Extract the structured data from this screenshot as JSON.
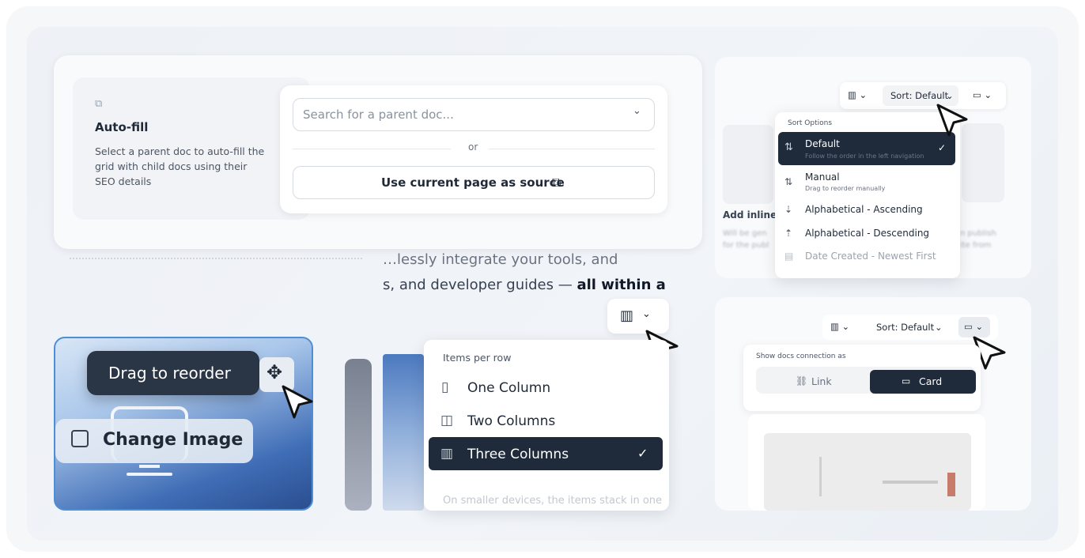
{
  "autofill": {
    "title": "Auto-fill",
    "description": "Select a parent doc to auto-fill the grid with child docs using their SEO details",
    "search_placeholder": "Search for a parent doc...",
    "or_text": "or",
    "use_current_label": "Use current page as source"
  },
  "background_text": {
    "line1": "…lessly integrate your tools, and",
    "line2_prefix": "s, and developer guides —",
    "line2_bold": "all within a"
  },
  "image_card": {
    "drag_label": "Drag to reorder",
    "change_image_label": "Change Image"
  },
  "columns_menu": {
    "header": "Items per row",
    "items": [
      {
        "label": "One Column",
        "icon": "one-column-icon"
      },
      {
        "label": "Two Columns",
        "icon": "two-columns-icon"
      },
      {
        "label": "Three Columns",
        "icon": "three-columns-icon",
        "selected": true
      }
    ],
    "footer": "On smaller devices, the items stack in one"
  },
  "sort_panel": {
    "toolbar_sort": "Sort: Default",
    "header": "Sort Options",
    "items": [
      {
        "label": "Default",
        "sub": "Follow the order in the left navigation",
        "selected": true
      },
      {
        "label": "Manual",
        "sub": "Drag to reorder manually"
      },
      {
        "label": "Alphabetical - Ascending"
      },
      {
        "label": "Alphabetical - Descending"
      },
      {
        "label": "Date Created - Newest First"
      }
    ],
    "ghost_title": "Add inline",
    "ghost_left": "Will be gen for the publ",
    "ghost_right": "n publish ite from"
  },
  "connection_panel": {
    "toolbar_sort": "Sort: Default",
    "header": "Show docs connection as",
    "link_label": "Link",
    "card_label": "Card"
  },
  "colors": {
    "dark": "#1f2a3a",
    "accent_border": "#4d8fd6"
  }
}
